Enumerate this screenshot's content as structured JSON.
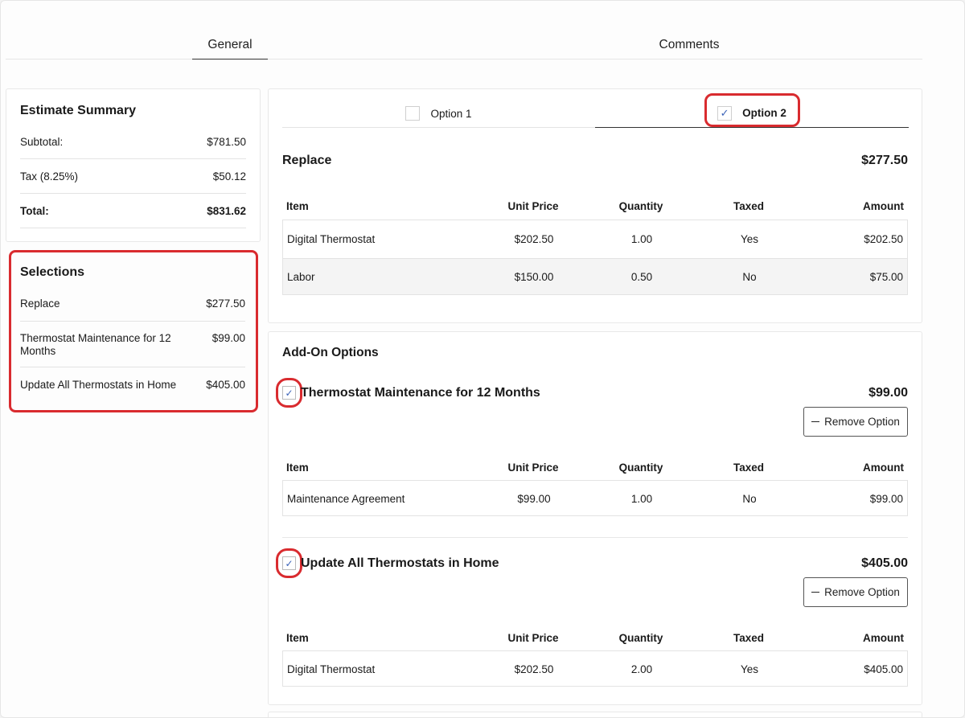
{
  "tabs": {
    "general": "General",
    "comments": "Comments"
  },
  "summary": {
    "title": "Estimate Summary",
    "rows": [
      {
        "label": "Subtotal:",
        "value": "$781.50"
      },
      {
        "label": "Tax (8.25%)",
        "value": "$50.12"
      },
      {
        "label": "Total:",
        "value": "$831.62"
      }
    ]
  },
  "selections": {
    "title": "Selections",
    "rows": [
      {
        "label": "Replace",
        "value": "$277.50"
      },
      {
        "label": "Thermostat Maintenance for 12 Months",
        "value": "$99.00"
      },
      {
        "label": "Update All Thermostats in Home",
        "value": "$405.00"
      }
    ]
  },
  "options": {
    "tabs": [
      {
        "label": "Option 1",
        "checked": false
      },
      {
        "label": "Option 2",
        "checked": true
      }
    ],
    "check_glyph": "✓",
    "section_title": "Replace",
    "section_price": "$277.50"
  },
  "table_headers": {
    "item": "Item",
    "unit": "Unit Price",
    "qty": "Quantity",
    "taxed": "Taxed",
    "amount": "Amount"
  },
  "replace_rows": [
    {
      "item": "Digital Thermostat",
      "unit": "$202.50",
      "qty": "1.00",
      "taxed": "Yes",
      "amount": "$202.50"
    },
    {
      "item": "Labor",
      "unit": "$150.00",
      "qty": "0.50",
      "taxed": "No",
      "amount": "$75.00"
    }
  ],
  "addons": {
    "title": "Add-On Options",
    "remove_label": "Remove Option",
    "items": [
      {
        "title": "Thermostat Maintenance for 12 Months",
        "price": "$99.00",
        "checked": true,
        "rows": [
          {
            "item": "Maintenance Agreement",
            "unit": "$99.00",
            "qty": "1.00",
            "taxed": "No",
            "amount": "$99.00"
          }
        ]
      },
      {
        "title": "Update All Thermostats in Home",
        "price": "$405.00",
        "checked": true,
        "rows": [
          {
            "item": "Digital Thermostat",
            "unit": "$202.50",
            "qty": "2.00",
            "taxed": "Yes",
            "amount": "$405.00"
          }
        ]
      }
    ]
  },
  "colors": {
    "highlight": "#d92b2f",
    "check": "#3b63b8"
  }
}
